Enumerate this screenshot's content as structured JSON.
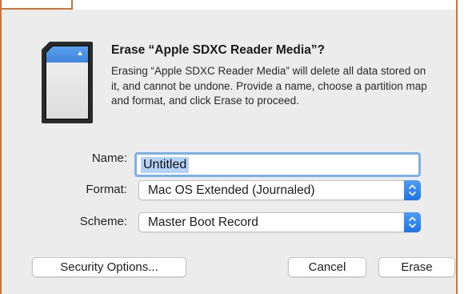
{
  "dialog": {
    "icon": "sd-card-icon",
    "title": "Erase “Apple SDXC Reader Media”?",
    "message": "Erasing “Apple SDXC Reader Media” will delete all data stored on it, and cannot be undone. Provide a name, choose a partition map and format, and click Erase to proceed."
  },
  "form": {
    "name_label": "Name:",
    "name_value": "Untitled",
    "format_label": "Format:",
    "format_value": "Mac OS Extended (Journaled)",
    "scheme_label": "Scheme:",
    "scheme_value": "Master Boot Record"
  },
  "buttons": {
    "security_options": "Security Options...",
    "cancel": "Cancel",
    "erase": "Erase"
  },
  "colors": {
    "accent": "#1f74e6",
    "focus_ring": "#7cb0ec",
    "selection": "#b4d3f7",
    "frame": "#c8763a"
  }
}
